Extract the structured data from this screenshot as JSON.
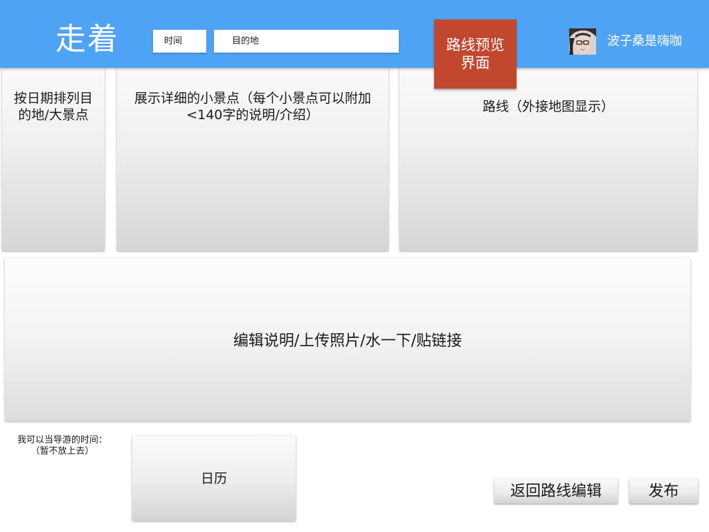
{
  "header": {
    "logo": "走着",
    "time_field": "时间",
    "destination_field": "目的地",
    "preview_badge": [
      "路线预览",
      "界面"
    ],
    "username": "波子桑是嗨咖"
  },
  "panels": {
    "dates": [
      "按日期排列目",
      "的地/大景点"
    ],
    "spots": [
      "展示详细的小景点（每个小景点可以附加",
      "<140字的说明/介绍）"
    ],
    "route": "路线（外接地图显示）",
    "edit": "编辑说明/上传照片/水一下/贴链接"
  },
  "bottom": {
    "guide_label": [
      "我可以当导游的时间：",
      "（暂不放上去）"
    ],
    "calendar": "日历",
    "back_button": "返回路线编辑",
    "publish_button": "发布"
  },
  "colors": {
    "header_bg": "#4fa3f4",
    "badge_bg": "#c2472f"
  }
}
